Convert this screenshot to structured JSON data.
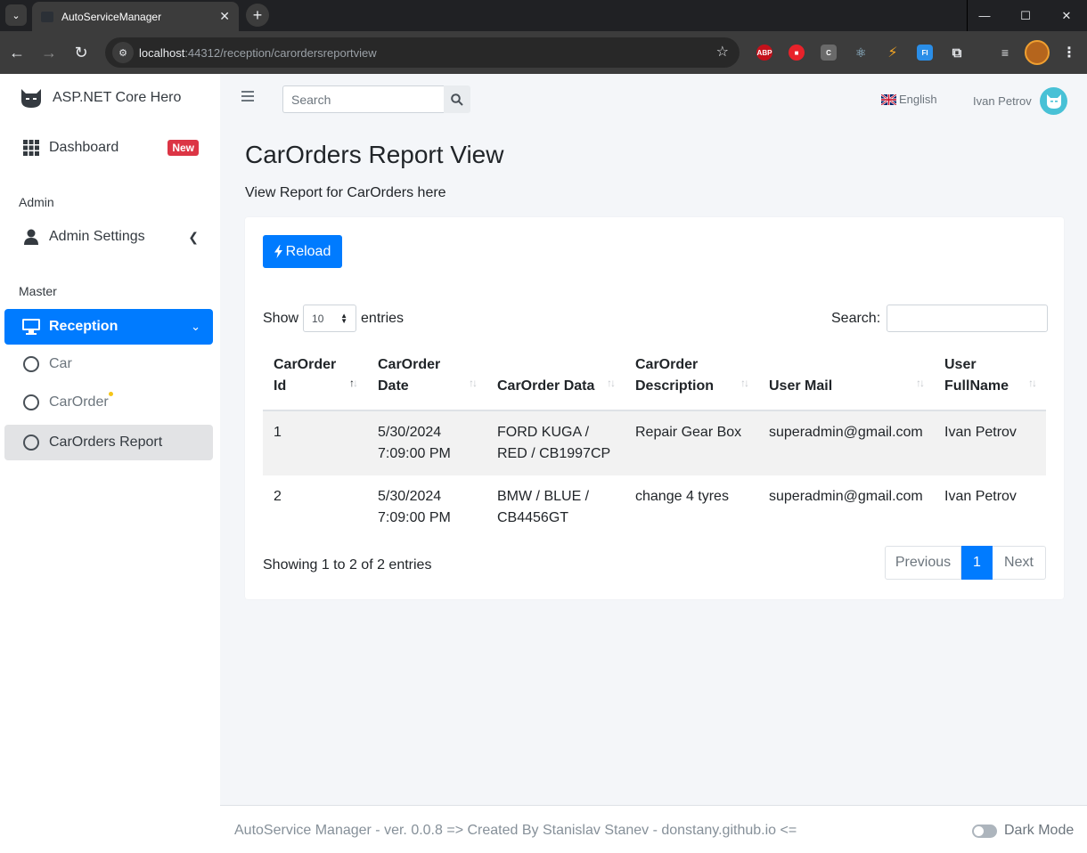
{
  "browser": {
    "tab_title": "AutoServiceManager",
    "url_host": "localhost",
    "url_rest": ":44312/reception/carordersreportview",
    "extensions": [
      "ABP",
      "C",
      "FI"
    ]
  },
  "sidebar": {
    "brand": "ASP.NET Core Hero",
    "dashboard": "Dashboard",
    "dashboard_badge": "New",
    "admin_header": "Admin",
    "admin_settings": "Admin Settings",
    "master_header": "Master",
    "reception": "Reception",
    "car": "Car",
    "car_order": "CarOrder",
    "car_orders_report": "CarOrders Report"
  },
  "topnav": {
    "search_placeholder": "Search",
    "language": "English",
    "user_name": "Ivan Petrov"
  },
  "page": {
    "title": "CarOrders Report View",
    "subtitle": "View Report for CarOrders here",
    "reload_label": "Reload",
    "show_label": "Show",
    "entries_label": "entries",
    "page_length": "10",
    "search_label": "Search:",
    "columns": [
      [
        "CarOrder",
        "Id"
      ],
      [
        "CarOrder",
        "Date"
      ],
      [
        "CarOrder Data"
      ],
      [
        "CarOrder",
        "Description"
      ],
      [
        "User Mail"
      ],
      [
        "User",
        "FullName"
      ]
    ],
    "rows": [
      {
        "id": "1",
        "date1": "5/30/2024",
        "date2": "7:09:00 PM",
        "data1": "FORD KUGA /",
        "data2": "RED / CB1997CP",
        "desc": "Repair Gear Box",
        "mail": "superadmin@gmail.com",
        "name": "Ivan Petrov"
      },
      {
        "id": "2",
        "date1": "5/30/2024",
        "date2": "7:09:00 PM",
        "data1": "BMW / BLUE /",
        "data2": "CB4456GT",
        "desc": "change 4 tyres",
        "mail": "superadmin@gmail.com",
        "name": "Ivan Petrov"
      }
    ],
    "info": "Showing 1 to 2 of 2 entries",
    "pager": {
      "previous": "Previous",
      "current": "1",
      "next": "Next"
    }
  },
  "footer": {
    "text": "AutoService Manager - ver. 0.0.8 => Created By Stanislav Stanev - donstany.github.io <=",
    "dark_mode": "Dark Mode"
  },
  "colors": {
    "primary": "#007bff",
    "danger": "#dc3545",
    "avatar": "#48c1d6"
  }
}
